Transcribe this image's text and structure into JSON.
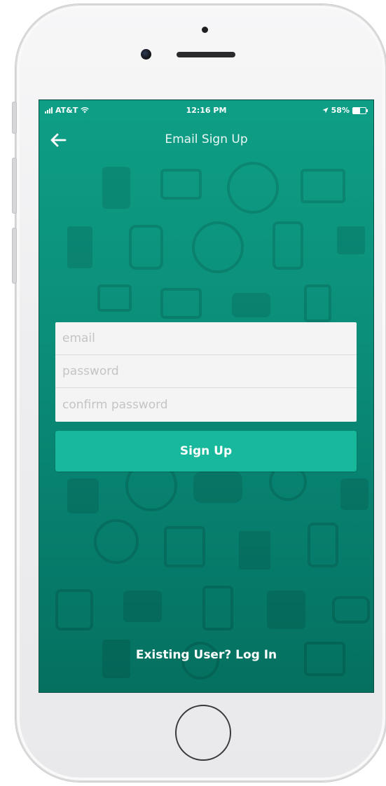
{
  "status_bar": {
    "carrier": "AT&T",
    "time": "12:16 PM",
    "battery": "58%",
    "battery_level": 0.58,
    "icons": [
      "signal-icon",
      "wifi-icon",
      "location-arrow-icon",
      "battery-icon"
    ]
  },
  "nav": {
    "back_icon": "arrow-left-icon",
    "title": "Email Sign Up"
  },
  "form": {
    "email_placeholder": "email",
    "email_value": "",
    "password_placeholder": "password",
    "password_value": "",
    "confirm_placeholder": "confirm password",
    "confirm_value": ""
  },
  "signup_button_label": "Sign Up",
  "existing_user_link": "Existing User? Log In",
  "colors": {
    "background": "#0b8e7a",
    "button": "#17b89b",
    "form_card": "#f4f4f4",
    "placeholder": "#c4c4c4"
  }
}
